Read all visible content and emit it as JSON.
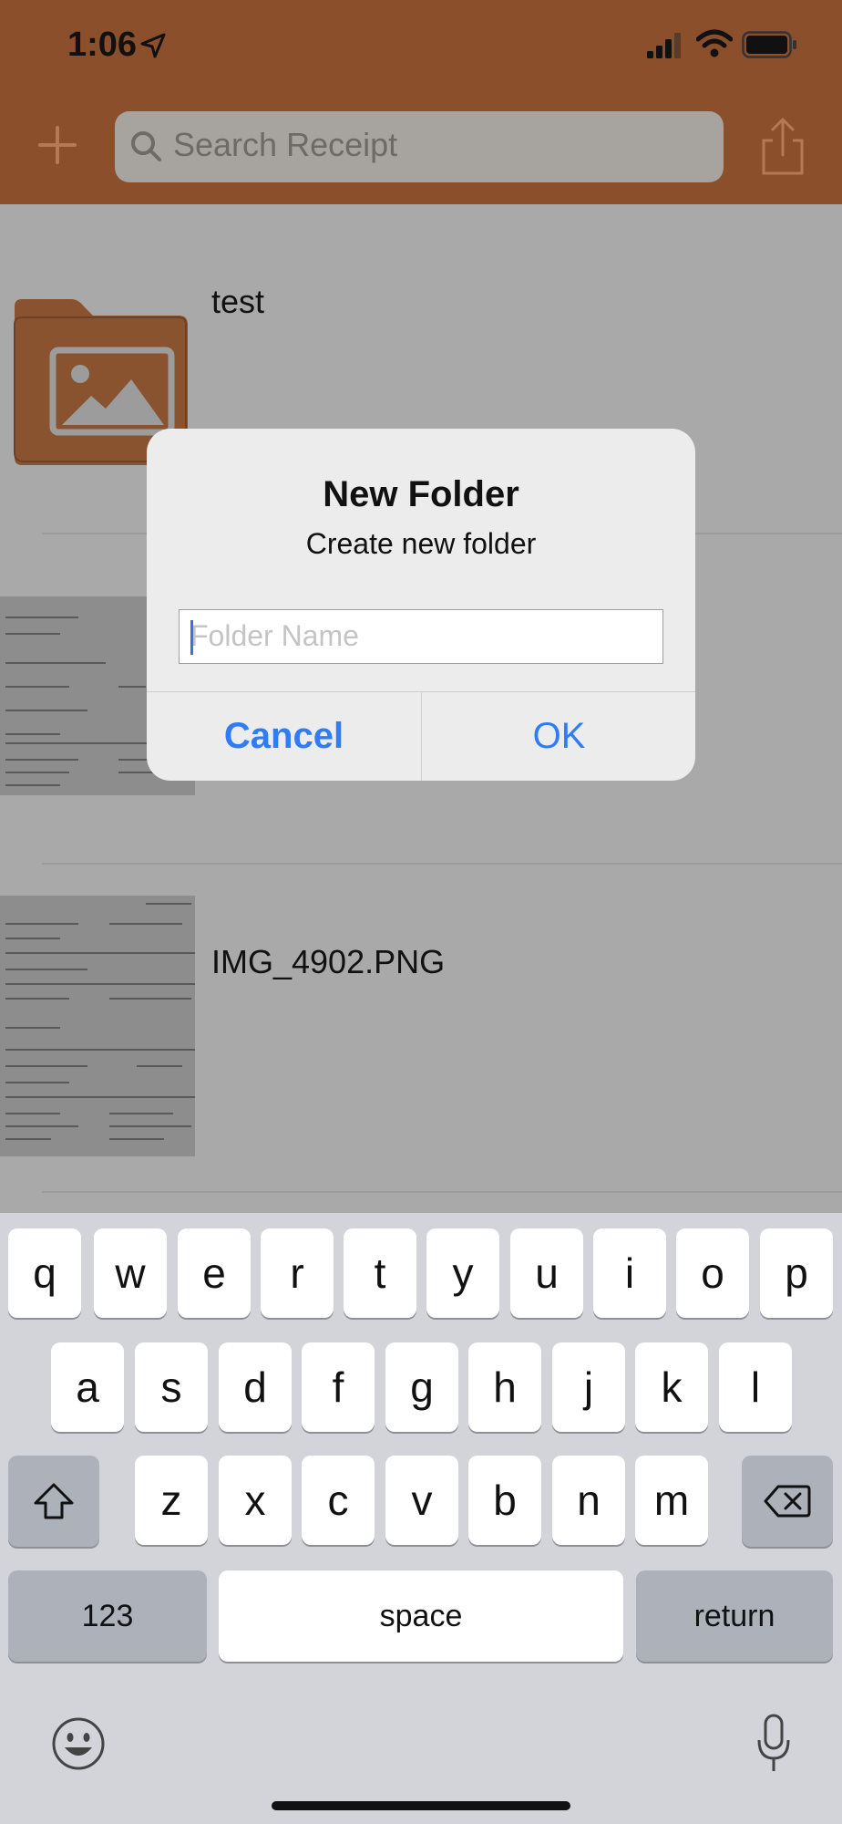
{
  "status_bar": {
    "time": "1:06"
  },
  "header": {
    "search_placeholder": "Search Receipt",
    "add_icon": "plus-icon",
    "share_icon": "share-icon",
    "brand_color": "#8c4f2c"
  },
  "list": {
    "items": [
      {
        "label": "test",
        "kind": "folder"
      },
      {
        "label": "",
        "kind": "receipt-image"
      },
      {
        "label": "IMG_4902.PNG",
        "kind": "receipt-image"
      }
    ]
  },
  "dialog": {
    "title": "New Folder",
    "message": "Create new folder",
    "input_placeholder": "Folder Name",
    "input_value": "",
    "cancel_label": "Cancel",
    "ok_label": "OK",
    "button_color": "#2f7cf6"
  },
  "keyboard": {
    "row1": [
      "q",
      "w",
      "e",
      "r",
      "t",
      "y",
      "u",
      "i",
      "o",
      "p"
    ],
    "row2": [
      "a",
      "s",
      "d",
      "f",
      "g",
      "h",
      "j",
      "k",
      "l"
    ],
    "row3": [
      "z",
      "x",
      "c",
      "v",
      "b",
      "n",
      "m"
    ],
    "numbers_label": "123",
    "space_label": "space",
    "return_label": "return",
    "shift_icon": "shift-icon",
    "delete_icon": "backspace-icon",
    "emoji_icon": "emoji-icon",
    "mic_icon": "microphone-icon"
  }
}
